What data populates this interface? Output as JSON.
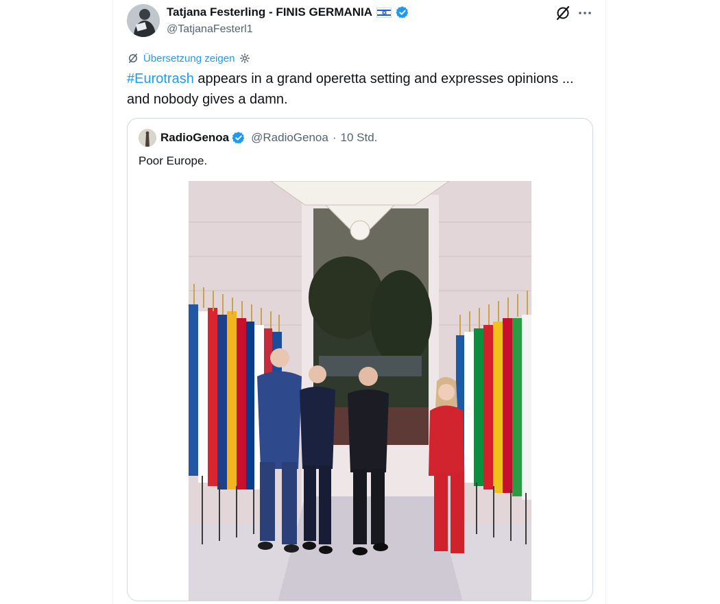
{
  "tweet": {
    "author_name": "Tatjana Festerling - FINIS GERMANIA",
    "author_handle": "@TatjanaFesterl1",
    "translate_label": "Übersetzung zeigen",
    "hashtag": "#Eurotrash",
    "text_after_hashtag": " appears in a grand operetta setting and expresses opinions ... and nobody gives a damn."
  },
  "quote": {
    "name": "RadioGenoa",
    "handle": "@RadioGenoa",
    "separator": "·",
    "time": "10 Std.",
    "text": "Poor Europe."
  },
  "icons": [
    "grok-icon",
    "more-icon",
    "verified-badge-icon",
    "translate-icon",
    "gear-icon",
    "israel-flag-icon"
  ],
  "colors": {
    "accent": "#1d9bf0",
    "text": "#0f1419",
    "muted": "#536471",
    "border": "#cfd9de"
  }
}
